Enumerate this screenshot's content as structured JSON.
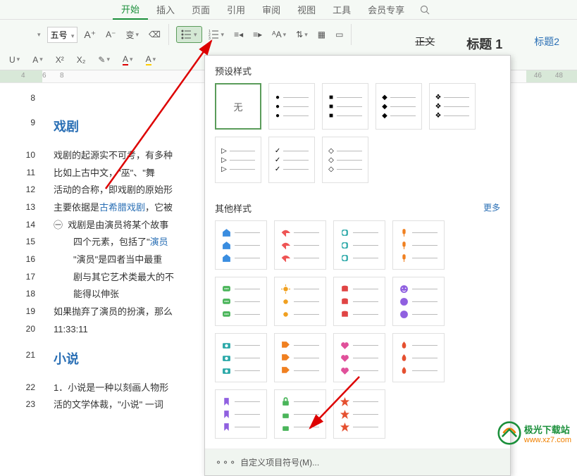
{
  "tabs": {
    "start": "开始",
    "insert": "插入",
    "page": "页面",
    "reference": "引用",
    "review": "审阅",
    "view": "视图",
    "tools": "工具",
    "member": "会员专享"
  },
  "toolbar": {
    "font_size": "五号"
  },
  "styles": {
    "normal": "正文",
    "heading1": "标题 1",
    "heading2": "标题2"
  },
  "ruler": {
    "n4": "4",
    "n6": "6",
    "n8": "8",
    "n46": "46",
    "n48": "48"
  },
  "doc": {
    "l8": {
      "num": "8",
      "text": ""
    },
    "l9": {
      "num": "9",
      "text": "戏剧"
    },
    "l10": {
      "num": "10",
      "text": "戏剧的起源实不可考，有多种"
    },
    "l11": {
      "num": "11",
      "text": "比如上古中文，\"巫\"、\"舞"
    },
    "l12": {
      "num": "12",
      "text": "活动的合称，即戏剧的原始形"
    },
    "l13": {
      "num": "13",
      "pre": "主要依据是",
      "link": "古希腊戏剧",
      "post": "，它被"
    },
    "l14": {
      "num": "14",
      "mark": "㊀",
      "text": "戏剧是由演员将某个故事"
    },
    "l15": {
      "num": "15",
      "pre": "四个元素，包括了\"",
      "link": "演员",
      "post": ""
    },
    "l16": {
      "num": "16",
      "text": "\"演员\"是四者当中最重"
    },
    "l17": {
      "num": "17",
      "text": "剧与其它艺术类最大的不"
    },
    "l18": {
      "num": "18",
      "text": "能得以伸张"
    },
    "l19": {
      "num": "19",
      "text": "如果抛弃了演员的扮演，那么"
    },
    "l20": {
      "num": "20",
      "text": "11:33:11"
    },
    "l21": {
      "num": "21",
      "text": "小说"
    },
    "l22": {
      "num": "22",
      "text": "1．小说是一种以刻画人物形"
    },
    "l23": {
      "num": "23",
      "text": "活的文学体裁，\"小说\" 一词"
    }
  },
  "dropdown": {
    "preset_title": "预设样式",
    "other_title": "其他样式",
    "more": "更多",
    "none": "无",
    "custom": "自定义项目符号(M)..."
  },
  "watermark": {
    "name": "极光下载站",
    "url": "www.xz7.com"
  }
}
